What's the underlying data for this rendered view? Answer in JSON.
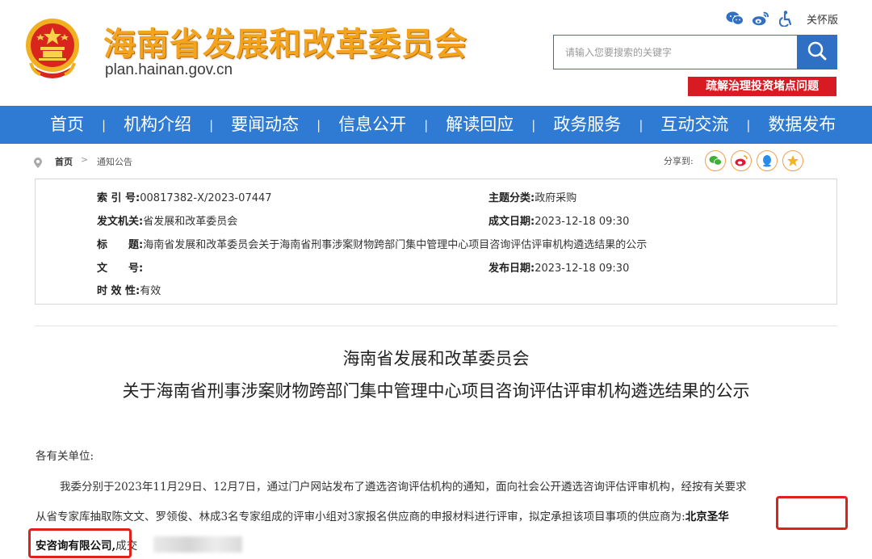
{
  "header": {
    "site_title": "海南省发展和改革委员会",
    "domain": "plan.hainan.gov.cn",
    "care_label": "关怀版",
    "search_placeholder": "请输入您要搜索的关键字",
    "promo_label": "疏解治理投资堵点问题",
    "icons": [
      "wechat-icon",
      "weibo-icon",
      "accessibility-icon"
    ]
  },
  "nav": {
    "items": [
      "首页",
      "机构介绍",
      "要闻动态",
      "信息公开",
      "解读回应",
      "政务服务",
      "互动交流",
      "数据发布"
    ]
  },
  "breadcrumb": {
    "home": "首页",
    "separator": ">",
    "current": "通知公告",
    "share_label": "分享到:"
  },
  "meta": {
    "index_label": "索 引 号:",
    "index_value": "00817382-X/2023-07447",
    "category_label": "主题分类:",
    "category_value": "政府采购",
    "issuer_label": "发文机关:",
    "issuer_value": "省发展和改革委员会",
    "written_label": "成文日期:",
    "written_value": "2023-12-18 09:30",
    "title_label": "标　　题:",
    "title_value": "海南省发展和改革委员会关于海南省刑事涉案财物跨部门集中管理中心项目咨询评估评审机构遴选结果的公示",
    "docno_label": "文　　号:",
    "docno_value": "",
    "published_label": "发布日期:",
    "published_value": "2023-12-18 09:30",
    "validity_label": "时 效 性:",
    "validity_value": "有效"
  },
  "article": {
    "title_line1": "海南省发展和改革委员会",
    "title_line2": "关于海南省刑事涉案财物跨部门集中管理中心项目咨询评估评审机构遴选结果的公示",
    "salutation": "各有关单位:",
    "para1_line1": "我委分别于2023年11月29日、12月7日，通过门户网站发布了遴选咨询评估机构的通知，面向社会公开遴选咨询评估评审机构，经按有关要求",
    "para1_line2": "从省专家库抽取陈文文、罗领俊、林成3名专家组成的评审小组对3家报名供应商的申报材料进行评审，拟定承担该项目事项的供应商为:",
    "highlight_part1": "北京圣华",
    "highlight_part2": "安咨询有限公司,",
    "para1_line3_tail": "成交"
  },
  "colors": {
    "nav_blue": "#2f7bd3",
    "title_gold": "#f4a31c",
    "promo_red": "#d81b22",
    "highlight_red": "#e0201a"
  }
}
